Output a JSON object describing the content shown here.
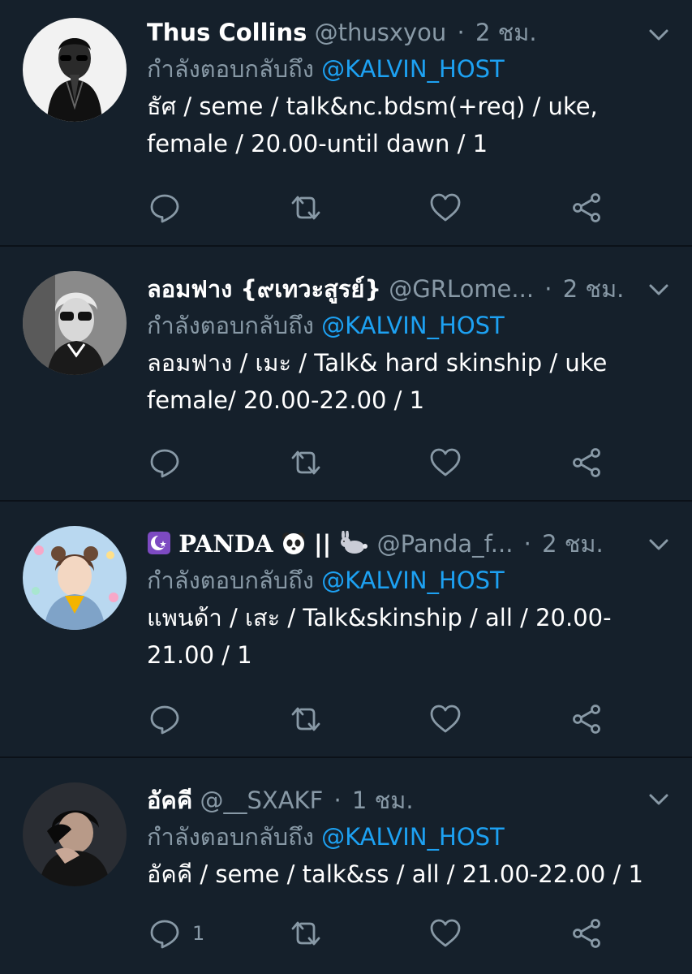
{
  "colors": {
    "background": "#15202b",
    "divider": "#0b1118",
    "text_primary": "#ffffff",
    "text_secondary": "#8899a6",
    "accent": "#1da1f2"
  },
  "reply_prefix": "กำลังตอบกลับถึง",
  "reply_target": "@KALVIN_HOST",
  "tweets": [
    {
      "display_name": "Thus Collins",
      "handle": "@thusxyou",
      "separator": "·",
      "time": "2 ชม.",
      "text": "ธัศ / seme / talk&nc.bdsm(+req) / uke, female / 20.00-until dawn / 1",
      "reply_count": "",
      "icons": [
        "reply-icon",
        "retweet-icon",
        "like-icon",
        "share-icon",
        "chevron-down-icon"
      ]
    },
    {
      "display_name": "ลอมฟาง {๙เทวะสูรย์}",
      "handle": "@GRLome...",
      "separator": "·",
      "time": "2 ชม.",
      "text": "ลอมฟาง / เมะ / Talk& hard skinship / uke female/ 20.00-22.00 / 1",
      "reply_count": "",
      "icons": [
        "reply-icon",
        "retweet-icon",
        "like-icon",
        "share-icon",
        "chevron-down-icon"
      ]
    },
    {
      "display_name_prefix_icon": "star-and-crescent-icon",
      "display_name": "PANDA",
      "display_name_icon": "panda-face-icon",
      "display_name_separator": "||",
      "display_name_suffix_icon": "rabbit-icon",
      "handle": "@Panda_f...",
      "separator": "·",
      "time": "2 ชม.",
      "text": "แพนด้า / เสะ / Talk&skinship / all / 20.00-21.00 / 1",
      "reply_count": "",
      "icons": [
        "reply-icon",
        "retweet-icon",
        "like-icon",
        "share-icon",
        "chevron-down-icon"
      ]
    },
    {
      "display_name": "อัคคี",
      "handle": "@__SXAKF",
      "separator": "·",
      "time": "1 ชม.",
      "text": "อัคคี / seme / talk&ss / all / 21.00-22.00 / 1",
      "reply_count": "1",
      "icons": [
        "reply-icon",
        "retweet-icon",
        "like-icon",
        "share-icon",
        "chevron-down-icon"
      ]
    }
  ]
}
